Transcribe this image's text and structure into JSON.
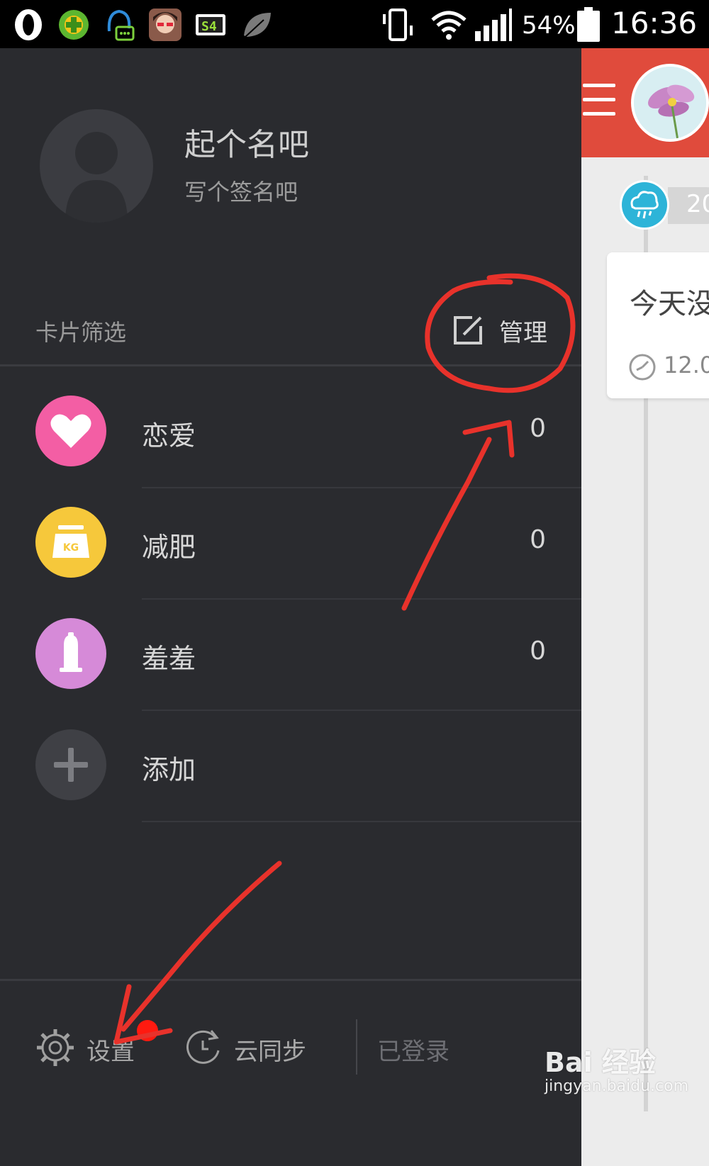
{
  "status_bar": {
    "battery": "54%",
    "time": "16:36",
    "icons": [
      "opera-icon",
      "360-security-icon",
      "qq-message-icon",
      "profile-photo-icon",
      "sim-icon",
      "leaf-icon",
      "vibrate-icon",
      "wifi-icon",
      "signal-icon",
      "battery-icon"
    ]
  },
  "drawer": {
    "profile": {
      "name": "起个名吧",
      "signature": "写个签名吧"
    },
    "filter": {
      "label": "卡片筛选",
      "manage_label": "管理"
    },
    "categories": [
      {
        "label": "恋爱",
        "count": "0",
        "icon": "heart-icon",
        "color": "#f35ea4"
      },
      {
        "label": "减肥",
        "count": "0",
        "icon": "scale-kg-icon",
        "icon_text": "KG",
        "color": "#f6c83b"
      },
      {
        "label": "羞羞",
        "count": "0",
        "icon": "condom-icon",
        "color": "#d68ad8"
      },
      {
        "label": "添加",
        "icon": "plus-icon",
        "color": "#3f4045"
      }
    ],
    "bottom": {
      "settings_label": "设置",
      "sync_label": "云同步",
      "logged_in_label": "已登录"
    }
  },
  "main": {
    "header_color": "#e04b3c",
    "date_partial": "20",
    "card_title": "今天没",
    "card_time": "12.0"
  },
  "watermark": {
    "main": "Bai 经验",
    "sub": "jingyan.baidu.com"
  },
  "annotation_color": "#e8322b"
}
